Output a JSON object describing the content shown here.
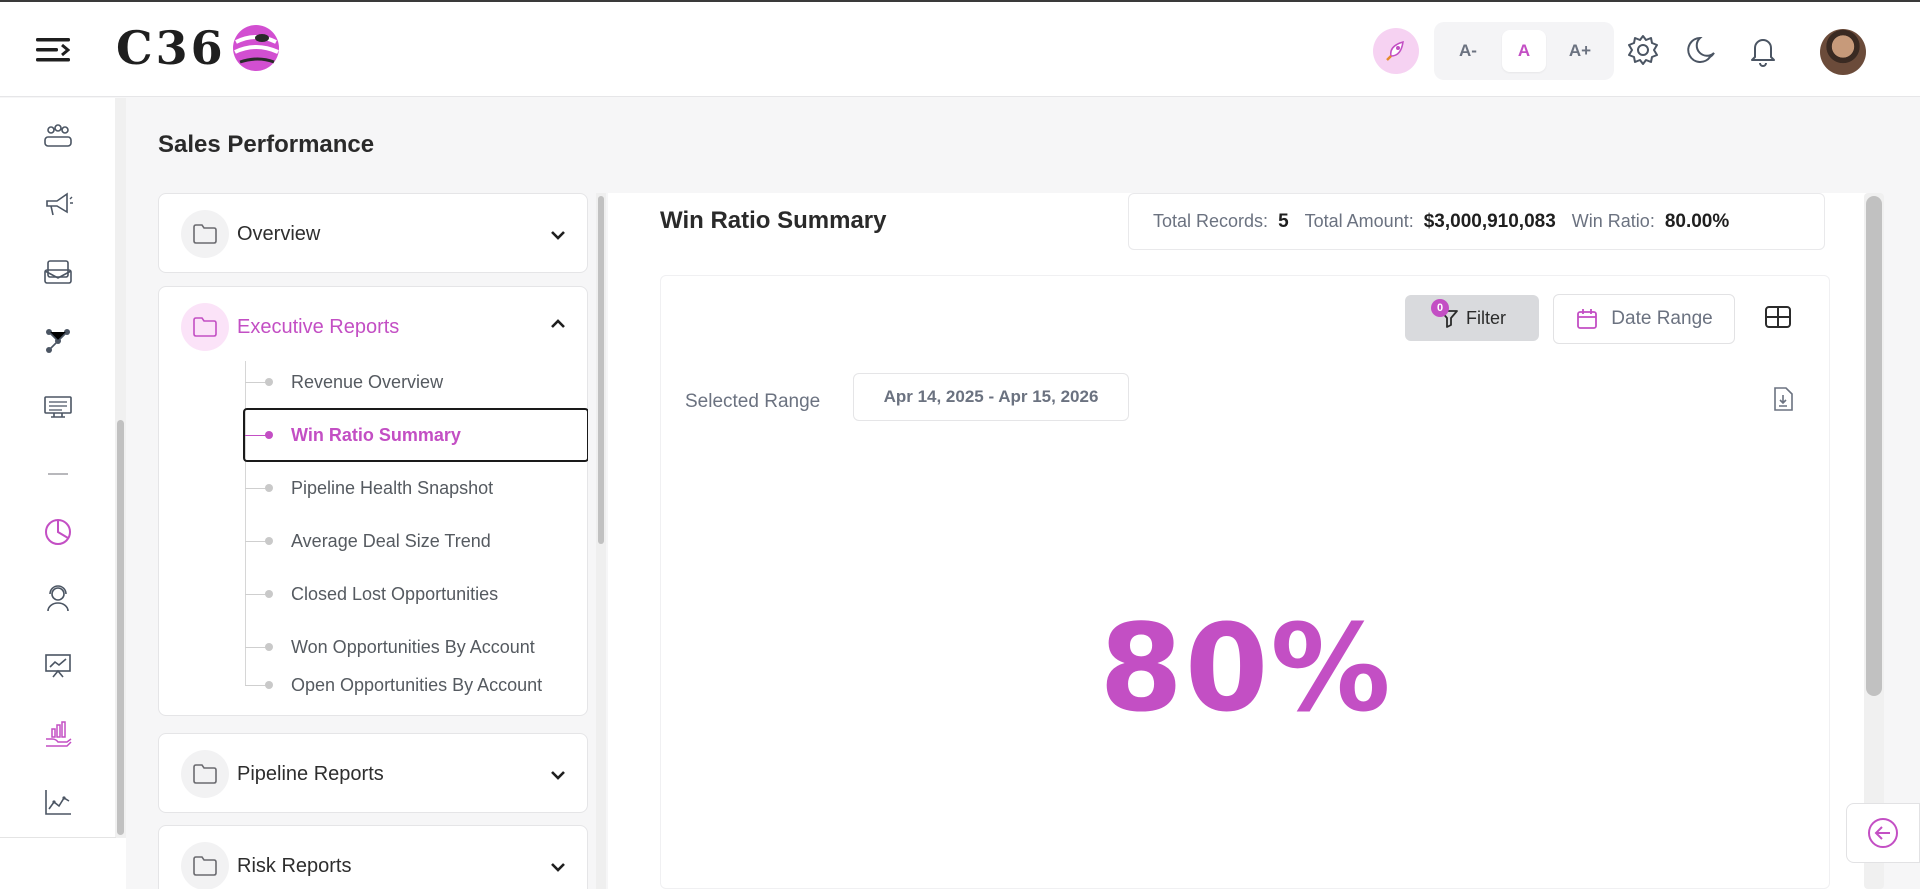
{
  "header": {
    "logo_text": "C36",
    "font_controls": {
      "decrease": "A-",
      "normal": "A",
      "increase": "A+"
    },
    "icons": [
      "menu-icon",
      "rocket-icon",
      "gear-icon",
      "moon-icon",
      "bell-icon",
      "avatar"
    ]
  },
  "rail": {
    "icons": [
      "team-icon",
      "megaphone-icon",
      "mail-icon",
      "network-icon",
      "monitor-icon",
      "dash-icon",
      "pie-chart-icon",
      "support-icon",
      "presentation-icon",
      "hand-chart-icon",
      "line-chart-icon"
    ]
  },
  "page": {
    "title": "Sales Performance"
  },
  "nav": {
    "groups": [
      {
        "label": "Overview"
      },
      {
        "label": "Executive Reports",
        "expanded": true
      },
      {
        "label": "Pipeline Reports"
      },
      {
        "label": "Risk Reports"
      }
    ],
    "executive_items": [
      "Revenue Overview",
      "Win Ratio Summary",
      "Pipeline Health Snapshot",
      "Average Deal Size Trend",
      "Closed Lost Opportunities",
      "Won Opportunities By Account",
      "Open Opportunities By Account"
    ],
    "active_item": "Win Ratio Summary"
  },
  "report": {
    "title": "Win Ratio Summary",
    "stats": {
      "total_records_label": "Total Records:",
      "total_records_value": "5",
      "total_amount_label": "Total Amount:",
      "total_amount_value": "$3,000,910,083",
      "win_ratio_label": "Win Ratio:",
      "win_ratio_value": "80.00%"
    },
    "filter_label": "Filter",
    "filter_count": "0",
    "date_range_label": "Date Range",
    "selected_range_label": "Selected Range",
    "selected_range_value": "Apr 14, 2025 - Apr 15, 2026",
    "metric": "80%"
  },
  "colors": {
    "accent": "#c34fc4",
    "accent_light": "#fbe3f8"
  }
}
